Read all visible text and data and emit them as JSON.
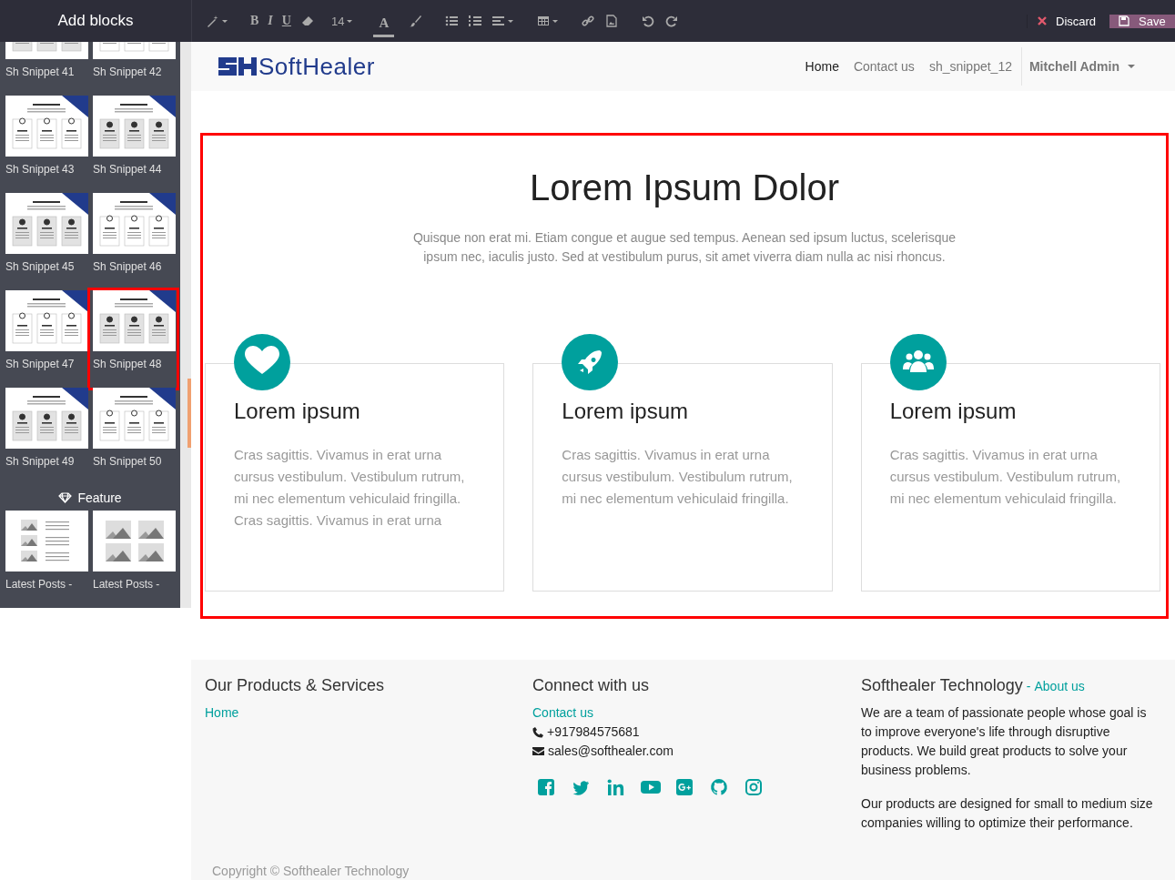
{
  "sidebar": {
    "title": "Add blocks",
    "snippets": [
      {
        "label": "Sh Snippet 41",
        "selected": false
      },
      {
        "label": "Sh Snippet 42",
        "selected": false
      },
      {
        "label": "Sh Snippet 43",
        "selected": false
      },
      {
        "label": "Sh Snippet 44",
        "selected": false
      },
      {
        "label": "Sh Snippet 45",
        "selected": false
      },
      {
        "label": "Sh Snippet 46",
        "selected": false
      },
      {
        "label": "Sh Snippet 47",
        "selected": false
      },
      {
        "label": "Sh Snippet 48",
        "selected": true
      },
      {
        "label": "Sh Snippet 49",
        "selected": false
      },
      {
        "label": "Sh Snippet 50",
        "selected": false
      }
    ],
    "section_title": "Feature",
    "features": [
      {
        "label": "Latest Posts -"
      },
      {
        "label": "Latest Posts -"
      }
    ]
  },
  "toolbar": {
    "bold": "B",
    "italic": "I",
    "underline": "U",
    "font_size": "14",
    "font_color": "A",
    "discard": "Discard",
    "save": "Save"
  },
  "header": {
    "logo": "SoftHealer",
    "nav": [
      {
        "label": "Home",
        "selected": true
      },
      {
        "label": "Contact us",
        "selected": false
      },
      {
        "label": "sh_snippet_12",
        "selected": false
      }
    ],
    "user": "Mitchell Admin"
  },
  "section": {
    "title": "Lorem Ipsum Dolor",
    "intro": "Quisque non erat mi. Etiam congue et augue sed tempus. Aenean sed ipsum luctus, scelerisque ipsum nec, iaculis justo. Sed at vestibulum purus, sit amet viverra diam nulla ac nisi rhoncus.",
    "cards": [
      {
        "kind": "heart",
        "title": "Lorem ipsum",
        "text": "Cras sagittis. Vivamus in erat urna cursus vestibulum. Vestibulum rutrum, mi nec elementum vehiculaid fringilla. Cras sagittis. Vivamus in erat urna"
      },
      {
        "kind": "rocket",
        "title": "Lorem ipsum",
        "text": "Cras sagittis. Vivamus in erat urna cursus vestibulum. Vestibulum rutrum, mi nec elementum vehiculaid fringilla."
      },
      {
        "kind": "users",
        "title": "Lorem ipsum",
        "text": "Cras sagittis. Vivamus in erat urna cursus vestibulum. Vestibulum rutrum, mi nec elementum vehiculaid fringilla."
      }
    ]
  },
  "footer": {
    "products": {
      "title": "Our Products & Services",
      "links": [
        "Home"
      ]
    },
    "connect": {
      "title": "Connect with us",
      "link": "Contact us",
      "phone": "+917984575681",
      "email": "sales@softhealer.com"
    },
    "about": {
      "title": "Softhealer Technology",
      "separator": "-",
      "link": "About us",
      "paragraphs": [
        "We are a team of passionate people whose goal is to improve everyone's life through disruptive products. We build great products to solve your business problems.",
        "Our products are designed for small to medium size companies willing to optimize their performance."
      ]
    },
    "copyright": "Copyright © Softhealer Technology"
  }
}
